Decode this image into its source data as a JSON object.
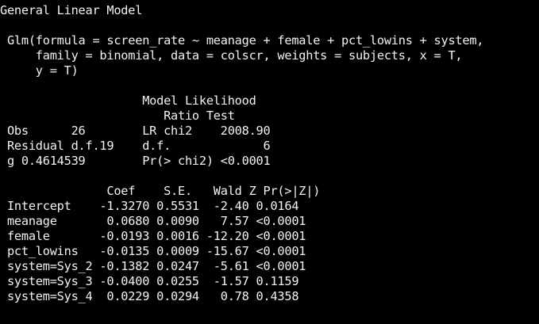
{
  "output": {
    "title": "General Linear Model",
    "call": [
      " Glm(formula = screen_rate ~ meanage + female + pct_lowins + system,",
      "     family = binomial, data = colscr, weights = subjects, x = T,",
      "     y = T)"
    ],
    "lr_header": [
      "                    Model Likelihood",
      "                       Ratio Test"
    ],
    "stats": [
      " Obs      26        LR chi2    2008.90",
      " Residual d.f.19    d.f.             6",
      " g 0.4614539        Pr(> chi2) <0.0001"
    ],
    "coef_header": "               Coef    S.E.   Wald Z Pr(>|Z|)",
    "coef_rows": [
      " Intercept    -1.3270 0.5531  -2.40 0.0164",
      " meanage       0.0680 0.0090   7.57 <0.0001",
      " female       -0.0193 0.0016 -12.20 <0.0001",
      " pct_lowins   -0.0135 0.0009 -15.67 <0.0001",
      " system=Sys_2 -0.1382 0.0247  -5.61 <0.0001",
      " system=Sys_3 -0.0400 0.0255  -1.57 0.1159",
      " system=Sys_4  0.0229 0.0294   0.78 0.4358"
    ]
  },
  "colors": {
    "background": "#000000",
    "text": "#f2f2f2"
  }
}
